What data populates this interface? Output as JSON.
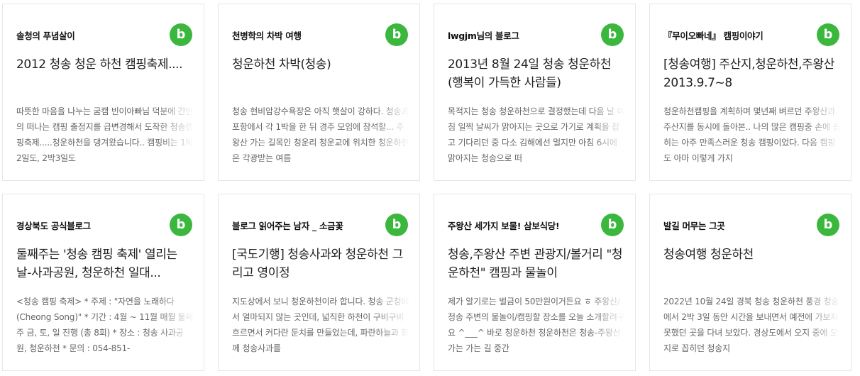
{
  "cards": [
    {
      "author": "솔청의 푸념살이",
      "badge": "b",
      "title": "2012 청송 청운 하천 캠핑축제....",
      "desc": "따뜻한 마음을 나누는 굼캠 빈이아빠님 덕분에 간만의 떠나는 캠핑 출정지를 급변경해서 도착한 청송캠핑축제.....청운하천을 댕겨왔습니다.. 캠핑비는 1박2일도, 2박3일도"
    },
    {
      "author": "천병학의 차박 여행",
      "badge": "b",
      "title": "청운하천 차박(청송)",
      "desc": "청송 현비암강수욕장은 아직 햇살이 강하다. 청송과 포항에서 각 1박을 한 뒤 경주 모임에 참석할... 주왕산 가는 길목인 청운리 청운교에 위치한 청운하천은 각광받는 여름"
    },
    {
      "author": "lwgjm님의 블로그",
      "badge": "b",
      "title": "2013년 8월 24일 청송 청운하천 (행복이 가득한 사람들)",
      "desc": "목적지는 청송 청운하천으로 결정했는데 다음 날 아침 일찍 날씨가 맑아지는 곳으로 가기로 계획을 잡고 기다리던 중 다소 김해에선 멀지만 아침 6시에 맑아지는 청송으로 떠"
    },
    {
      "author": "『무이오빠네』 캠핑이야기",
      "badge": "b",
      "title": "[청송여행]  주산지,청운하천,주왕산 2013.9.7~8",
      "desc": "청운하천캠핑을 계획하며 몇년째 벼르던 주왕산과 주산지를 동시에 돌아본.. 나의 많은 캠핑중 손에 꼽히는 아주 만족스러운 청송 캠핑이었다. 다음 캠핑도 아마 이렇게 가지"
    },
    {
      "author": "경상북도 공식블로그",
      "badge": "b",
      "title": "둘째주는 '청송 캠핑 축제' 열리는 날-사과공원, 청운하천 일대...",
      "desc": "<청송 캠핑 축제> * 주제 : \"자연을 노래하다(Cheong Song)\" * 기간 : 4월 ~ 11월 매월 둘째주 금, 토, 일 진행 (총 8회) * 장소 : 청송 사과공원, 청운하천 * 문의 : 054-851-"
    },
    {
      "author": "블로그 읽어주는 남자 _ 소금꽃",
      "badge": "b",
      "title": "[국도기행] 청송사과와 청운하천 그리고 영이정",
      "desc": "지도상에서 보니 청운하천이라 합니다. 청송 군청에서 얼마되지 않는 곳인데, 넓직한 하천이 구비구비 흐르면서 커다란 둔치를 만들었는데, 파란하늘과 함께 청송사과를"
    },
    {
      "author": "주왕산 세가지 보물!  삼보식당!",
      "badge": "b",
      "title": "청송,주왕산 주변 관광지/볼거리 \"청운하천\" 캠핑과 물놀이",
      "desc": "제가 알기로는 벌금이 50만원이거든요 ㅎ 주왕산/청송 주변의 물놀이/캠핑할 장소를 오늘 소개할려구요 ^___^ 바로 청운하천 청운하천은 청송-주왕산 가는 가는 길 중간"
    },
    {
      "author": "발길 머무는 그곳",
      "badge": "b",
      "title": "청송여행 청운하천",
      "desc": "2022년 10월 24일 경북 청송 청운하천 풍경 청송에서 2박 3일 동안 시간을 보내면서 예전에 가보지 못했던 곳을 다녀 보았다. 경상도에서 오지 중에 오지로 꼽히던 청송지"
    }
  ],
  "colors": {
    "badge": "#3bb73e",
    "border": "#e6e6e6"
  },
  "icons": {
    "badge": "blog-b-icon"
  }
}
